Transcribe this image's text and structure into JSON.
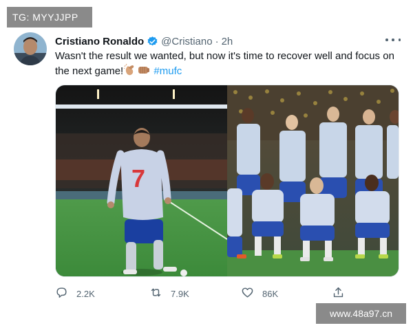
{
  "watermark": {
    "top_label": "TG: MYYJJPP",
    "bottom_label": "www.48a97.cn"
  },
  "tweet": {
    "author_name": "Cristiano Ronaldo",
    "handle": "@Cristiano",
    "separator": "·",
    "time": "2h",
    "verified": true,
    "text_line1": "Wasn't the result we wanted, but now it's time to recover well and focus on",
    "text_line2": "the next game!",
    "emojis": [
      "clapping-hands-emoji",
      "fist-bump-emoji"
    ],
    "hashtag": "#mufc",
    "media": [
      "player-walking-photo",
      "team-photo"
    ]
  },
  "actions": {
    "reply_count": "2.2K",
    "retweet_count": "7.9K",
    "like_count": "86K"
  },
  "colors": {
    "accent": "#1d9bf0",
    "secondary_text": "#536471",
    "primary_text": "#0f1419",
    "watermark_bg": "#8a8a8a"
  }
}
